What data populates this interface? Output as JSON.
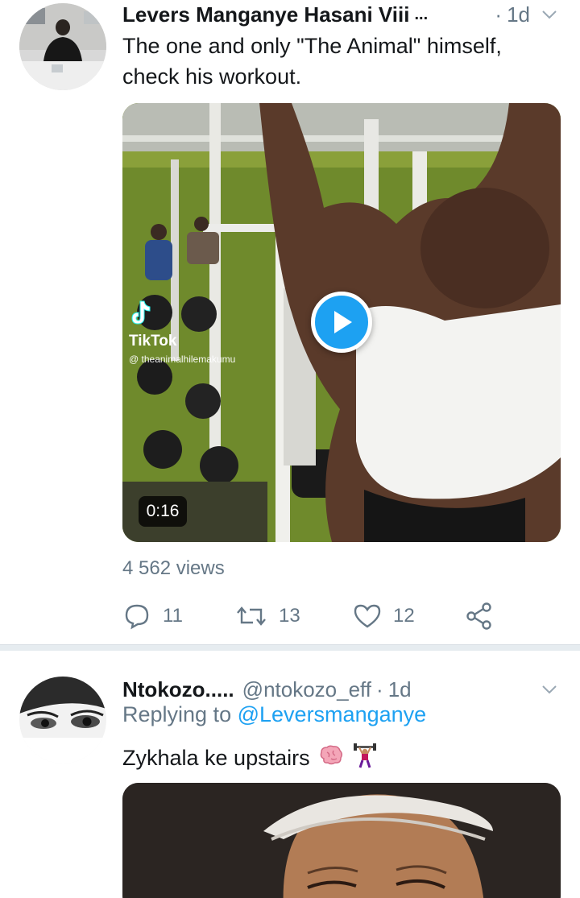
{
  "tweet1": {
    "author_name": "Levers Manganye Hasani Viii",
    "name_ellipsis": "...",
    "time": "1d",
    "text": "The one and only \"The Animal\" himself, check his workout.",
    "video": {
      "duration": "0:16",
      "tiktok_label": "TikTok",
      "tiktok_user": "@ theanimalhilemakumu"
    },
    "views": "4 562 views",
    "actions": {
      "replies": "11",
      "retweets": "13",
      "likes": "12"
    }
  },
  "tweet2": {
    "author_name": "Ntokozo.....",
    "handle": "@ntokozo_eff",
    "time": "1d",
    "replying_prefix": "Replying to",
    "replying_handle": "@Leversmanganye",
    "text": "Zykhala ke upstairs"
  },
  "colors": {
    "accent": "#1da1f2",
    "secondary_text": "#657786",
    "primary_text": "#14171a",
    "separator": "#e6ecf0"
  },
  "icons": [
    "chevron-down-icon",
    "play-icon",
    "tiktok-logo-icon",
    "reply-icon",
    "retweet-icon",
    "like-icon",
    "share-icon",
    "brain-emoji-icon",
    "weightlifter-emoji-icon"
  ]
}
